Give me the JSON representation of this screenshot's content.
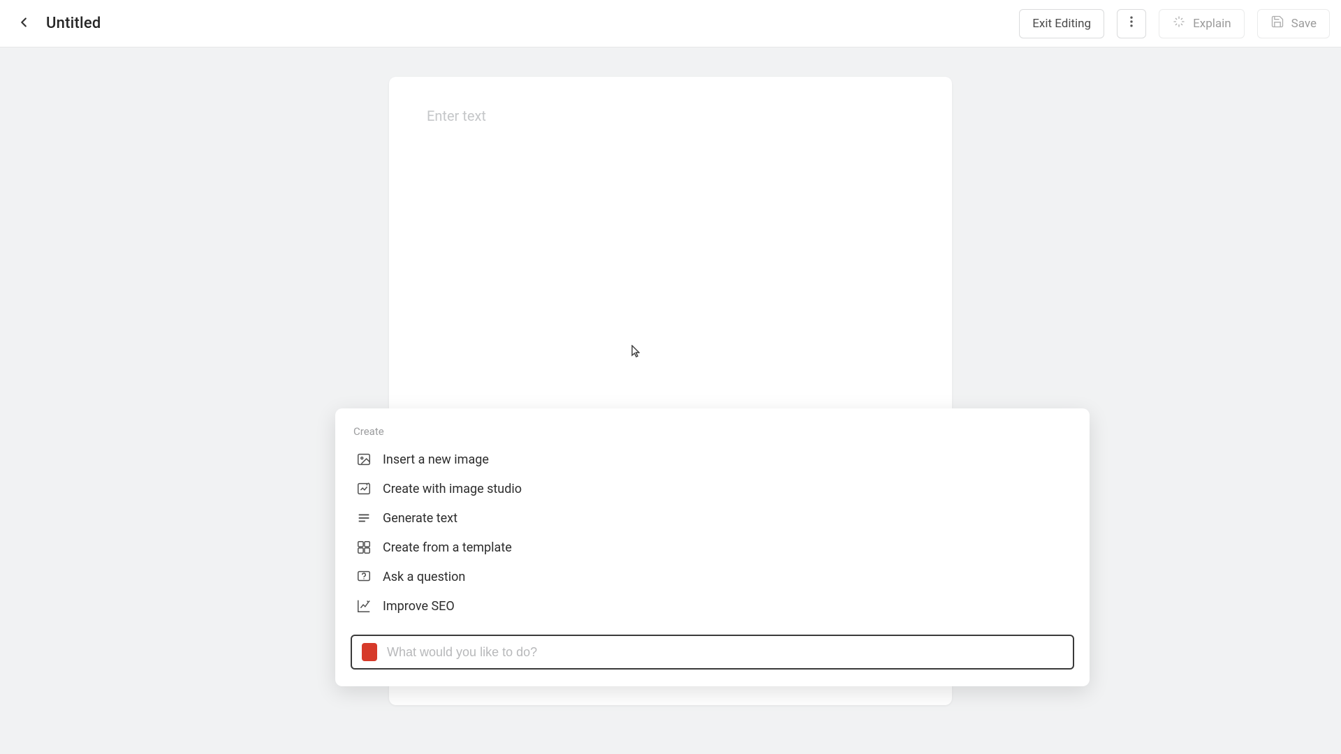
{
  "header": {
    "title": "Untitled",
    "exit_label": "Exit Editing",
    "explain_label": "Explain",
    "save_label": "Save"
  },
  "document": {
    "placeholder": "Enter text"
  },
  "command_panel": {
    "section_label": "Create",
    "items": [
      {
        "icon": "image-icon",
        "label": "Insert a new image"
      },
      {
        "icon": "image-studio-icon",
        "label": "Create with image studio"
      },
      {
        "icon": "text-lines-icon",
        "label": "Generate text"
      },
      {
        "icon": "template-icon",
        "label": "Create from a template"
      },
      {
        "icon": "question-icon",
        "label": "Ask a question"
      },
      {
        "icon": "seo-icon",
        "label": "Improve SEO"
      }
    ],
    "input_placeholder": "What would you like to do?"
  }
}
